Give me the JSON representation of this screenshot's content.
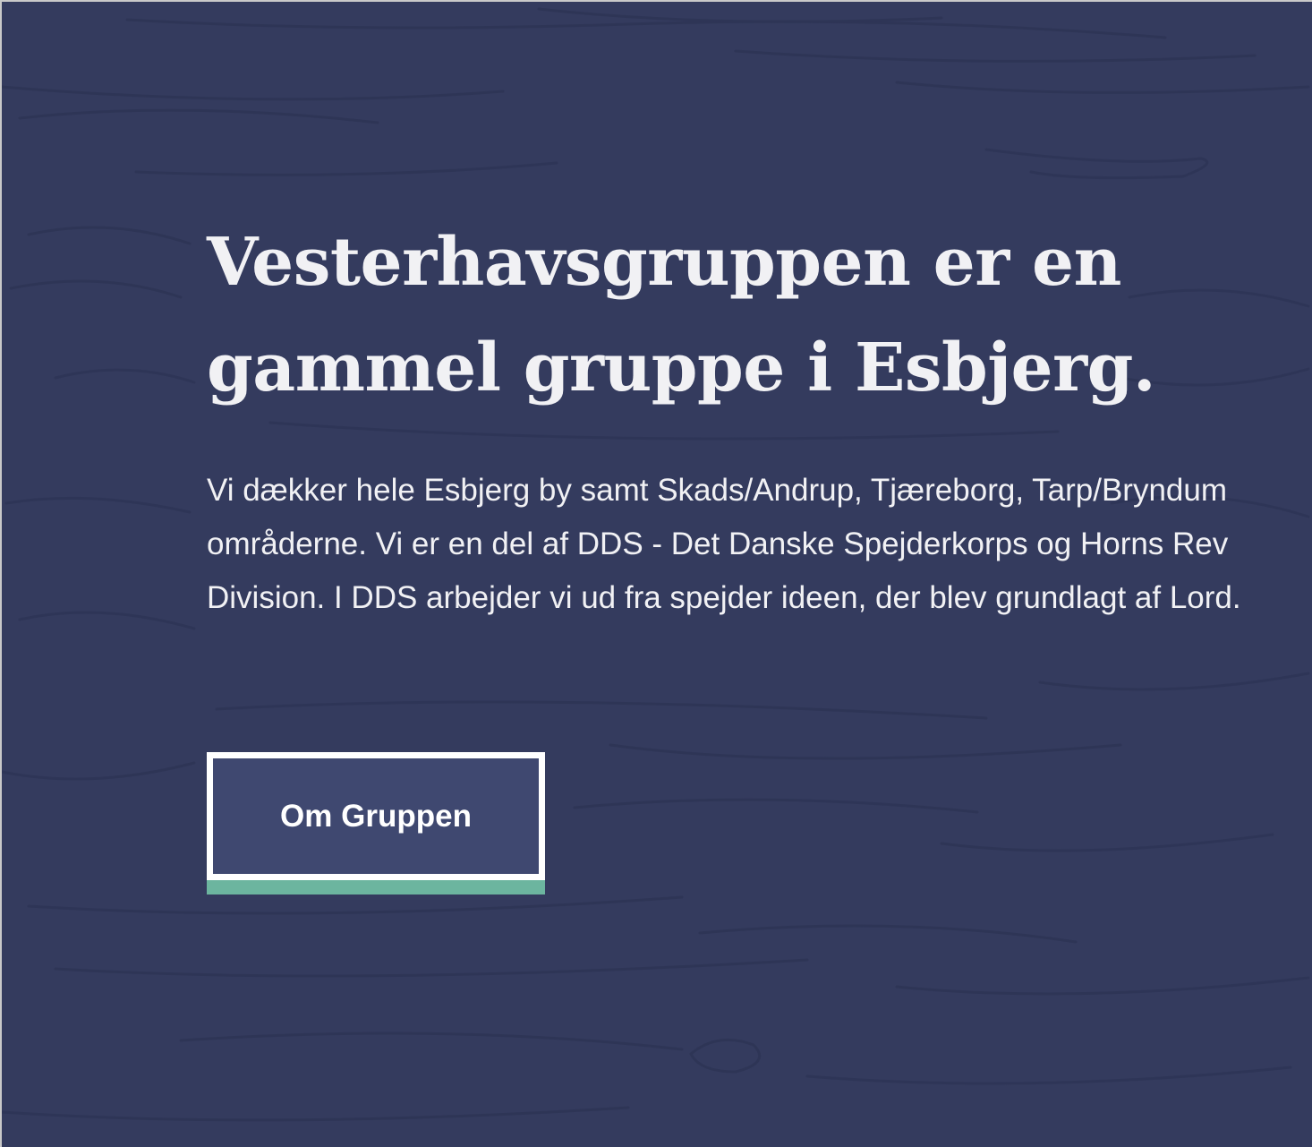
{
  "hero": {
    "headline": "Vesterhavsgruppen er en gammel gruppe i Esbjerg.",
    "intro": "Vi dækker hele Esbjerg by samt Skads/Andrup, Tjæreborg, Tarp/Bryndum områderne. Vi er en del af DDS - Det Danske Spejderkorps og Horns Rev Division. I DDS arbejder vi ud fra spejder ideen, der blev grundlagt af Lord.",
    "cta_label": "Om Gruppen"
  },
  "colors": {
    "background": "#343b5e",
    "button_fill": "#3f4870",
    "accent": "#6cb59f",
    "text": "#f1f1f4"
  }
}
